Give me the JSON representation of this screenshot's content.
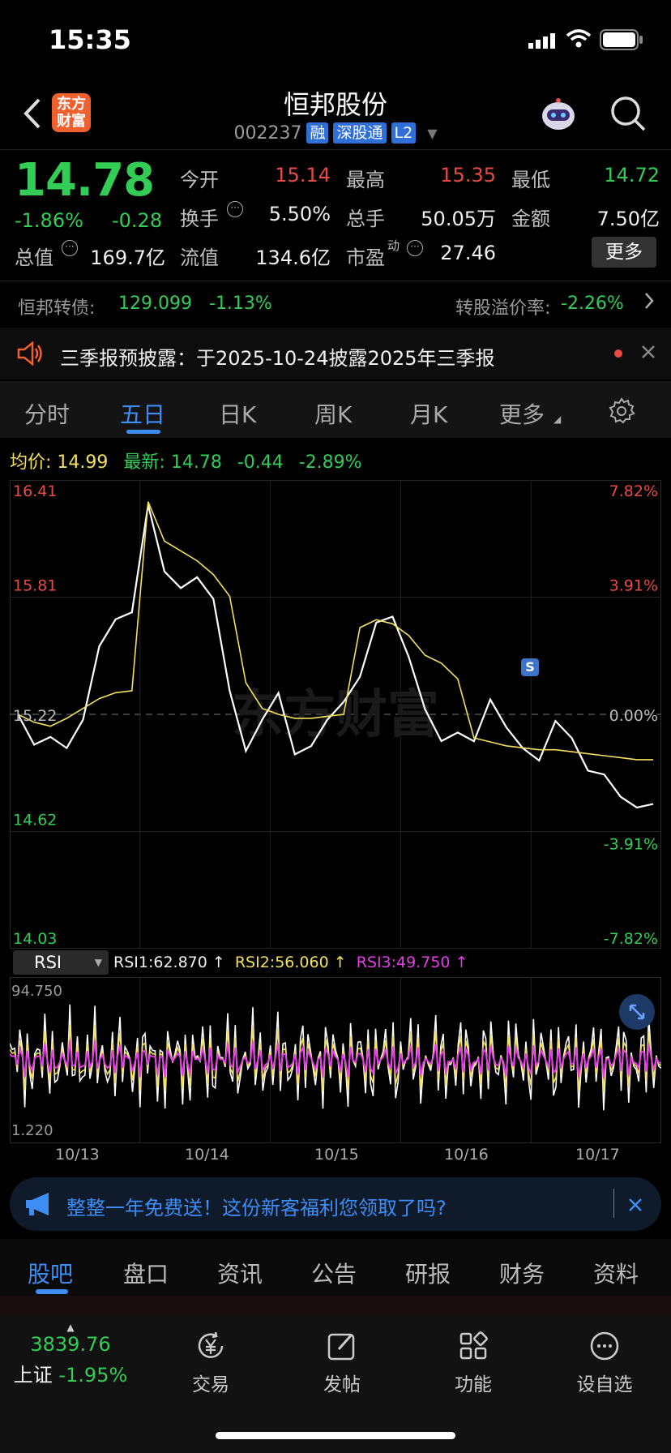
{
  "status_bar": {
    "time": "15:35"
  },
  "header": {
    "logo_text": "东方\n财富",
    "stock_name": "恒邦股份",
    "stock_code": "002237",
    "tags": [
      "融",
      "深股通",
      "L2"
    ]
  },
  "quote": {
    "price": "14.78",
    "change_pct": "-1.86%",
    "change_amt": "-0.28",
    "open_label": "今开",
    "open": "15.14",
    "high_label": "最高",
    "high": "15.35",
    "low_label": "最低",
    "low": "14.72",
    "turnover_label": "换手",
    "turnover": "5.50%",
    "volume_label": "总手",
    "volume": "50.05万",
    "amount_label": "金额",
    "amount": "7.50亿",
    "mktcap_label": "总值",
    "mktcap": "169.7亿",
    "float_label": "流值",
    "float_cap": "134.6亿",
    "pe_label": "市盈",
    "pe_sup": "动",
    "pe": "27.46",
    "more_label": "更多"
  },
  "bond": {
    "label": "恒邦转债:",
    "price": "129.099",
    "change": "-1.13%",
    "premium_label": "转股溢价率:",
    "premium": "-2.26%"
  },
  "notice": {
    "text": "三季报预披露：于2025-10-24披露2025年三季报"
  },
  "chart_tabs": [
    "分时",
    "五日",
    "日K",
    "周K",
    "月K",
    "更多"
  ],
  "chart_info": {
    "avg_label": "均价:",
    "avg": "14.99",
    "latest_label": "最新:",
    "latest": "14.78",
    "chg": "-0.44",
    "chg_pct": "-2.89%"
  },
  "chart_data": {
    "type": "line",
    "title": "",
    "x": [
      "10/13",
      "10/14",
      "10/15",
      "10/16",
      "10/17"
    ],
    "ylim": [
      14.03,
      16.41
    ],
    "y_ticks_left": [
      "16.41",
      "15.81",
      "15.22",
      "14.62",
      "14.03"
    ],
    "y_ticks_right": [
      "7.82%",
      "3.91%",
      "0.00%",
      "-3.91%",
      "-7.82%"
    ],
    "series": [
      {
        "name": "最新",
        "color": "#ffffff",
        "values": [
          15.22,
          15.08,
          15.12,
          15.05,
          15.18,
          15.55,
          15.7,
          15.75,
          16.3,
          15.95,
          15.85,
          15.9,
          15.8,
          15.35,
          15.05,
          15.2,
          15.32,
          15.0,
          15.05,
          15.2,
          15.3,
          15.42,
          15.68,
          15.7,
          15.5,
          15.25,
          15.1,
          15.14,
          15.08,
          15.28,
          15.14,
          15.05,
          15.0,
          15.2,
          15.1,
          14.92,
          14.9,
          14.8,
          14.76,
          14.78
        ]
      },
      {
        "name": "均价",
        "color": "#f5e05c",
        "values": [
          15.22,
          15.18,
          15.16,
          15.2,
          15.25,
          15.3,
          15.33,
          15.34,
          16.3,
          16.1,
          16.05,
          16.0,
          15.93,
          15.82,
          15.38,
          15.25,
          15.22,
          15.2,
          15.2,
          15.21,
          15.22,
          15.66,
          15.7,
          15.68,
          15.62,
          15.52,
          15.48,
          15.4,
          15.1,
          15.08,
          15.06,
          15.05,
          15.04,
          15.04,
          15.03,
          15.02,
          15.01,
          15.0,
          14.99,
          14.99
        ]
      }
    ]
  },
  "rsi": {
    "label": "RSI",
    "rsi1": "RSI1:62.870 ↑",
    "rsi2": "RSI2:56.060 ↑",
    "rsi3": "RSI3:49.750 ↑",
    "max": "94.750",
    "min": "1.220"
  },
  "promo": {
    "text": "整整一年免费送！这份新客福利您领取了吗?"
  },
  "section_tabs": [
    "股吧",
    "盘口",
    "资讯",
    "公告",
    "研报",
    "财务",
    "资料"
  ],
  "index": {
    "value": "3839.76",
    "name": "上证",
    "change": "-1.95%"
  },
  "nav": [
    "交易",
    "发帖",
    "功能",
    "设自选"
  ],
  "colors": {
    "up": "#e84a45",
    "down": "#33cc55",
    "accent": "#3d8df5",
    "avg_line": "#f5e05c"
  }
}
